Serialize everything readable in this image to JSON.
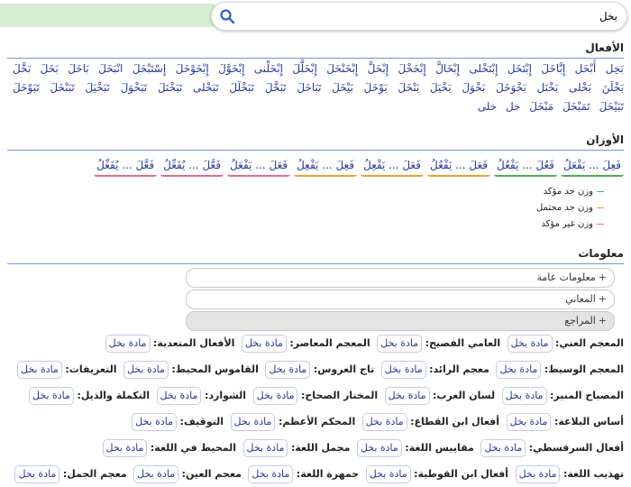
{
  "search": {
    "value": "بخل"
  },
  "sections": {
    "verbs_title": "الأفعال",
    "weights_title": "الأوزان",
    "info_title": "معلومات"
  },
  "verbs": [
    "بَخِل",
    "أَبْخَل",
    "إِبَّاخَلَ",
    "إِبْتَخَل",
    "إِبْتَخْلى",
    "إِبْخَالَّ",
    "إِبْخَخْلَ",
    "إِبْخَلَّ",
    "إِبْخَنْخَلَ",
    "إِبْخَلَّلَ",
    "إِبْخَلْنى",
    "إِبْخَوَّلَ",
    "إِبْخَوْخَلَ",
    "إِسْتَبْخَلَ",
    "انْبَخَلَ",
    "بَاخَلَ",
    "بَخَلَ",
    "بَخَّلَ",
    "بَخْلَنَ",
    "بَخْلى",
    "بَخْنَل",
    "بَخْوَخَلَ",
    "بَخْوَلَ",
    "بَخْيَلَ",
    "بَنْخَلَ",
    "بَوْخَلَ",
    "بَيْخَلَ",
    "تَبَاخَلَ",
    "تَبَخَّلَ",
    "تَبَخْلَلَ",
    "تَبَخْلى",
    "تَبَخْنَلَ",
    "تَبَخْوَلَ",
    "تَبَخْيَلَ",
    "تَبَنْخَلَ",
    "تَبَوْخَلَ",
    "تَبَيْخَلَ",
    "تَمَبْخَلَ",
    "مَبْخَلَ",
    "خل",
    "خلى"
  ],
  "weights": [
    {
      "label": "فَعِلَ ... يَفْعَلُ",
      "color": "#4caf50"
    },
    {
      "label": "فَعُلَ ... يَفْعُلُ",
      "color": "#4caf50"
    },
    {
      "label": "فَعَلَ ... يَفْعُلُ",
      "color": "#f0a030"
    },
    {
      "label": "فَعَلَ ... يَفْعِلُ",
      "color": "#f0a030"
    },
    {
      "label": "فَعِلَ ... يَفْعِلُ",
      "color": "#f0a030"
    },
    {
      "label": "فَعَلَ ... يَفْعَلُ",
      "color": "#e46a8a"
    },
    {
      "label": "فَعَّلَ ... يُفَعِّلُ",
      "color": "#e46a8a"
    },
    {
      "label": "فَعَّلَ ... يُفَعِّلُ",
      "color": "#e46a8a"
    }
  ],
  "legend": [
    {
      "label": "وزن جد مؤكد",
      "color": "#4caf50"
    },
    {
      "label": "وزن جد محتمل",
      "color": "#f0a030"
    },
    {
      "label": "وزن غير مؤكد",
      "color": "#e46a8a"
    }
  ],
  "accordions": [
    {
      "label": "معلومات عامة",
      "active": false
    },
    {
      "label": "المعاني",
      "active": false
    },
    {
      "label": "المراجع",
      "active": true
    }
  ],
  "references": [
    {
      "name": "المعجم الغني:",
      "link": "مادة بخل"
    },
    {
      "name": "العامي الفصيح:",
      "link": "مادة بخل"
    },
    {
      "name": "المعجم المعاصر:",
      "link": "مادة بخل"
    },
    {
      "name": "الأفعال المتعدية:",
      "link": "مادة بخل"
    },
    {
      "name": "المعجم الوسيط:",
      "link": "مادة بخل"
    },
    {
      "name": "معجم الرائد:",
      "link": "مادة بخل"
    },
    {
      "name": "تاج العروس:",
      "link": "مادة بخل"
    },
    {
      "name": "القاموس المحيط:",
      "link": "مادة بخل"
    },
    {
      "name": "التعريفات:",
      "link": "مادة بخل"
    },
    {
      "name": "المصباح المنير:",
      "link": "مادة بخل"
    },
    {
      "name": "لسان العرب:",
      "link": "مادة بخل"
    },
    {
      "name": "المختار الصحاح:",
      "link": "مادة بخل"
    },
    {
      "name": "الشوارد:",
      "link": "مادة بخل"
    },
    {
      "name": "التكملة والذيل:",
      "link": "مادة بخل"
    },
    {
      "name": "أساس البلاغة:",
      "link": "مادة بخل"
    },
    {
      "name": "أفعال ابن القطاع:",
      "link": "مادة بخل"
    },
    {
      "name": "المحكم الأعظم:",
      "link": "مادة بخل"
    },
    {
      "name": "التوقيف:",
      "link": "مادة بخل"
    },
    {
      "name": "أفعال السرقسطي:",
      "link": "مادة بخل"
    },
    {
      "name": "مقاييس اللغة:",
      "link": "مادة بخل"
    },
    {
      "name": "مجمل اللغة:",
      "link": "مادة بخل"
    },
    {
      "name": "المحيط في اللغة:",
      "link": "مادة بخل"
    },
    {
      "name": "تهذيب اللغة:",
      "link": "مادة بخل"
    },
    {
      "name": "أفعال ابن القوطية:",
      "link": "مادة بخل"
    },
    {
      "name": "جمهرة اللغة:",
      "link": "مادة بخل"
    },
    {
      "name": "معجم العين:",
      "link": "مادة بخل"
    },
    {
      "name": "معجم الجمل:",
      "link": "مادة بخل"
    }
  ]
}
